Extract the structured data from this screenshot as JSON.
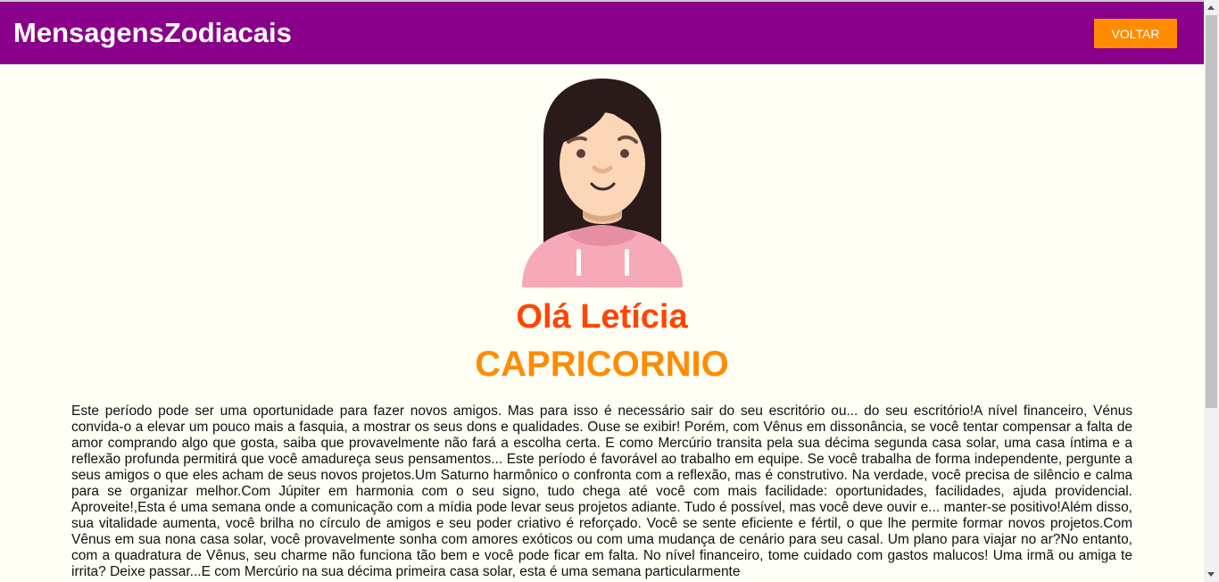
{
  "header": {
    "brand": "MensagensZodiacais",
    "back_label": "VOLTAR",
    "background": "#8a008a",
    "button_color": "#ff8c00"
  },
  "avatar": {
    "icon": "girl-avatar-icon"
  },
  "greeting": "Olá Letícia",
  "sign": "CAPRICORNIO",
  "message": "Este período pode ser uma oportunidade para fazer novos amigos. Mas para isso é necessário sair do seu escritório ou... do seu escritório!A nível financeiro, Vénus convida-o a elevar um pouco mais a fasquia, a mostrar os seus dons e qualidades. Ouse se exibir! Porém, com Vênus em dissonância, se você tentar compensar a falta de amor comprando algo que gosta, saiba que provavelmente não fará a escolha certa. E como Mercúrio transita pela sua décima segunda casa solar, uma casa íntima e a reflexão profunda permitirá que você amadureça seus pensamentos... Este período é favorável ao trabalho em equipe. Se você trabalha de forma independente, pergunte a seus amigos o que eles acham de seus novos projetos.Um Saturno harmônico o confronta com a reflexão, mas é construtivo. Na verdade, você precisa de silêncio e calma para se organizar melhor.Com Júpiter em harmonia com o seu signo, tudo chega até você com mais facilidade: oportunidades, facilidades, ajuda providencial. Aproveite!,Esta é uma semana onde a comunicação com a mídia pode levar seus projetos adiante. Tudo é possível, mas você deve ouvir e... manter-se positivo!Além disso, sua vitalidade aumenta, você brilha no círculo de amigos e seu poder criativo é reforçado. Você se sente eficiente e fértil, o que lhe permite formar novos projetos.Com Vênus em sua nona casa solar, você provavelmente sonha com amores exóticos ou com uma mudança de cenário para seu casal. Um plano para viajar no ar?No entanto, com a quadratura de Vênus, seu charme não funciona tão bem e você pode ficar em falta. No nível financeiro, tome cuidado com gastos malucos! Uma irmã ou amiga te irrita? Deixe passar...E com Mercúrio na sua décima primeira casa solar, esta é uma semana particularmente"
}
